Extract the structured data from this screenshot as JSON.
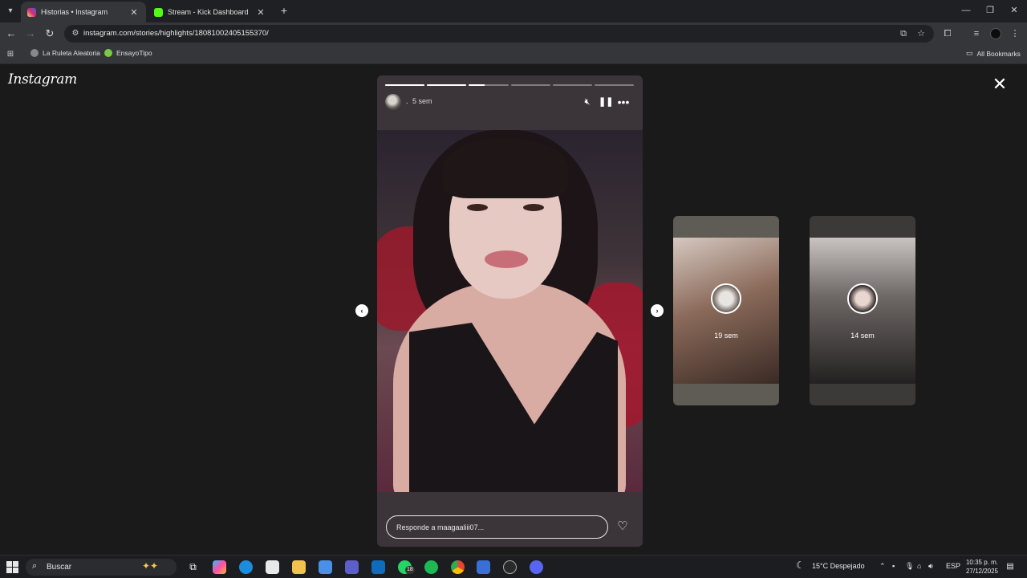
{
  "browser": {
    "tabs": [
      {
        "title": "Historias • Instagram",
        "active": true,
        "favicon_color": "#e1306c"
      },
      {
        "title": "Stream - Kick Dashboard",
        "active": false,
        "favicon_color": "#53fc18"
      }
    ],
    "url": "instagram.com/stories/highlights/18081002405155370/",
    "bookmarks": [
      {
        "label": "La Ruleta Aleatoria",
        "icon_color": "#888888"
      },
      {
        "label": "EnsayoTipo",
        "icon_color": "#7ac943"
      }
    ],
    "all_bookmarks_label": "All Bookmarks"
  },
  "instagram": {
    "logo": "Instagram",
    "story": {
      "username": ".",
      "time_ago": "5 sem",
      "progress_segments": [
        1,
        1,
        0.4,
        0,
        0,
        0
      ],
      "reply_placeholder": "Responde a maagaaliii07..."
    },
    "previews": [
      {
        "time_ago": "19 sem"
      },
      {
        "time_ago": "14 sem"
      }
    ]
  },
  "taskbar": {
    "search_placeholder": "Buscar",
    "weather": "15°C  Despejado",
    "language": "ESP",
    "time": "10:35 p. m.",
    "date": "27/12/2025",
    "whatsapp_badge": "18"
  },
  "colors": {
    "page_bg": "#1a1a1a",
    "chrome_bg": "#35363a",
    "instagram_pink": "#e1306c",
    "kick_green": "#53fc18"
  }
}
